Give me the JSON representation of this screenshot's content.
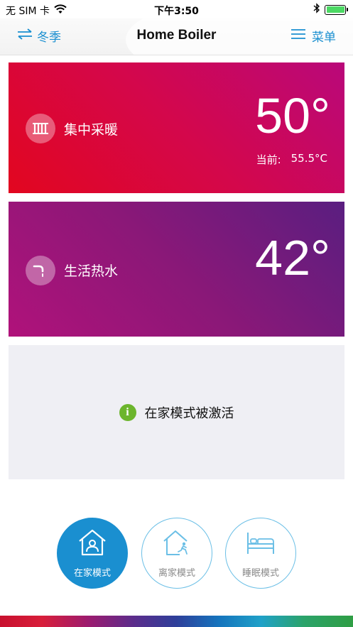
{
  "status_bar": {
    "carrier": "无 SIM 卡",
    "time": "下午3:50"
  },
  "nav": {
    "season_label": "冬季",
    "title": "Home Boiler",
    "menu_label": "菜单"
  },
  "heating": {
    "label": "集中采暖",
    "setpoint": "50°",
    "current_label": "当前:",
    "current_value": "55.5°C"
  },
  "hot_water": {
    "label": "生活热水",
    "setpoint": "42°"
  },
  "info": {
    "message": "在家模式被激活"
  },
  "modes": [
    {
      "label": "在家模式",
      "icon": "home-person-icon",
      "active": true
    },
    {
      "label": "离家模式",
      "icon": "home-leave-icon",
      "active": false
    },
    {
      "label": "睡眠模式",
      "icon": "bed-icon",
      "active": false
    }
  ],
  "colors": {
    "accent": "#1a8fd0",
    "heating_card": "#d4074b",
    "water_card": "#8a1878",
    "info_ok": "#6cb52d"
  }
}
